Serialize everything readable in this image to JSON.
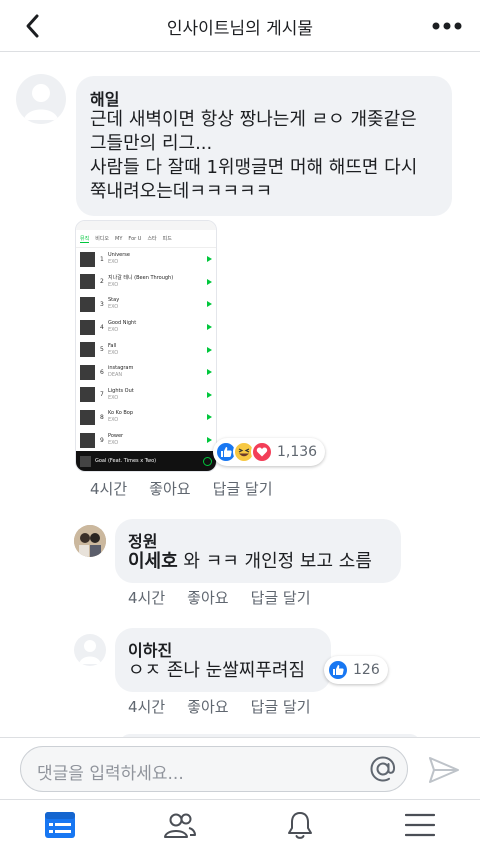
{
  "header": {
    "title": "인사이트님의 게시물"
  },
  "comments": [
    {
      "author": "해일",
      "lines": [
        "근데 새벽이면 항상 짱나는게 ㄹㅇ 개좆같은",
        "그들만의 리그...",
        "사람들 다 잘때 1위맹글면 머해 해뜨면 다시",
        "쭉내려오는데ㅋㅋㅋㅋㅋ"
      ],
      "time": "4시간",
      "like_label": "좋아요",
      "reply_label": "답글 달기",
      "reaction_count": "1,136",
      "screenshot": {
        "tabs": [
          "뮤직",
          "비디오",
          "MY",
          "For U",
          "스타",
          "피드"
        ],
        "songs": [
          {
            "rank": "1",
            "title": "Universe",
            "artist": "EXO"
          },
          {
            "rank": "2",
            "title": "지나갈 테니 (Been Through)",
            "artist": "EXO"
          },
          {
            "rank": "3",
            "title": "Stay",
            "artist": "EXO"
          },
          {
            "rank": "4",
            "title": "Good Night",
            "artist": "EXO"
          },
          {
            "rank": "5",
            "title": "Fall",
            "artist": "EXO"
          },
          {
            "rank": "6",
            "title": "instagram",
            "artist": "DEAN"
          },
          {
            "rank": "7",
            "title": "Lights Out",
            "artist": "EXO"
          },
          {
            "rank": "8",
            "title": "Ko Ko Bop",
            "artist": "EXO"
          },
          {
            "rank": "9",
            "title": "Power",
            "artist": "EXO"
          }
        ],
        "now_playing": "Goal (Feat. Times x Two)"
      }
    },
    {
      "author": "정원",
      "tag": "이세호",
      "text": " 와 ㅋㅋ 개인정 보고 소름",
      "time": "4시간",
      "like_label": "좋아요",
      "reply_label": "답글 달기"
    },
    {
      "author": "이하진",
      "text": "ㅇㅈ 존나 눈쌀찌푸려짐",
      "time": "4시간",
      "like_label": "좋아요",
      "reply_label": "답글 달기",
      "reaction_count": "126"
    }
  ],
  "composer": {
    "placeholder": "댓글을 입력하세요..."
  },
  "tabbar": {
    "icons": [
      "news-feed-icon",
      "friends-icon",
      "notifications-icon",
      "menu-icon"
    ]
  },
  "colors": {
    "accent": "#1877f2",
    "bubble": "#f0f2f5",
    "like": "#1877f2",
    "haha": "#f7c843",
    "love": "#f33e58",
    "player_green": "#00c73c"
  }
}
